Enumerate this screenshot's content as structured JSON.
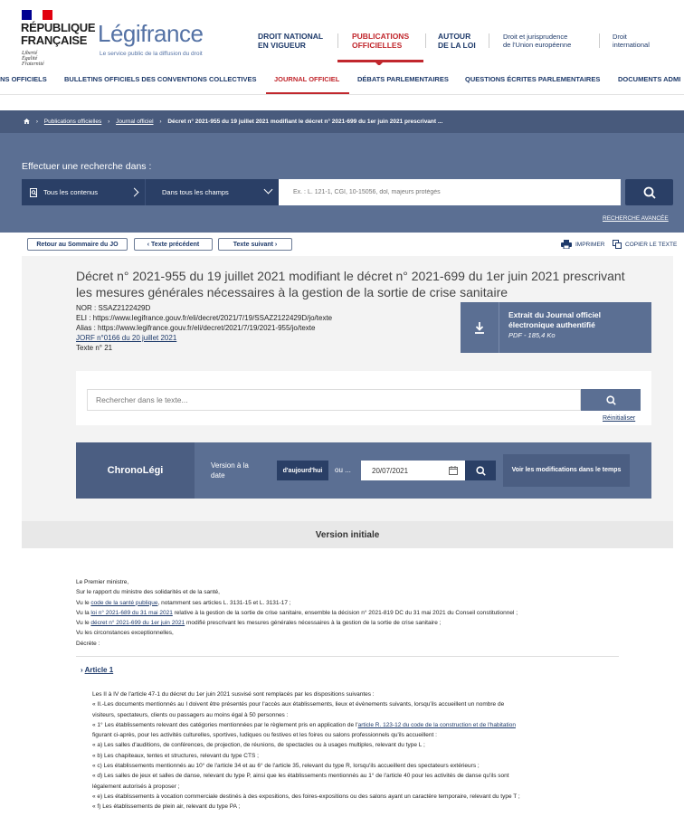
{
  "header": {
    "republic_line1": "RÉPUBLIQUE",
    "republic_line2": "FRANÇAISE",
    "motto1": "Liberté",
    "motto2": "Égalité",
    "motto3": "Fraternité",
    "logo": "Légifrance",
    "tagline": "Le service public de la diffusion du droit",
    "nav": [
      {
        "line1": "DROIT NATIONAL",
        "line2": "EN VIGUEUR"
      },
      {
        "line1": "PUBLICATIONS",
        "line2": "OFFICIELLES"
      },
      {
        "line1": "AUTOUR",
        "line2": "DE LA LOI"
      },
      {
        "line1": "Droit et jurisprudence",
        "line2": "de l'Union européenne"
      },
      {
        "line1": "Droit",
        "line2": "international"
      }
    ]
  },
  "subnav": [
    "INS OFFICIELS",
    "BULLETINS OFFICIELS DES CONVENTIONS COLLECTIVES",
    "JOURNAL OFFICIEL",
    "DÉBATS PARLEMENTAIRES",
    "QUESTIONS ÉCRITES PARLEMENTAIRES",
    "DOCUMENTS ADMI"
  ],
  "breadcrumb": {
    "item1": "Publications officielles",
    "item2": "Journal officiel",
    "current": "Décret n° 2021-955 du 19 juillet 2021 modifiant le décret n° 2021-699 du 1er juin 2021 prescrivant ..."
  },
  "search": {
    "label": "Effectuer une recherche dans :",
    "scope": "Tous les contenus",
    "fields": "Dans tous les champs",
    "placeholder": "Ex. : L. 121-1, CGI, 10-15056, dol, majeurs protégés",
    "advanced": "RECHERCHE AVANCÉE"
  },
  "toolbar": {
    "back": "Retour au Sommaire du JO",
    "prev": "‹ Texte précédent",
    "next": "Texte suivant ›",
    "print": "IMPRIMER",
    "copy": "COPIER LE TEXTE"
  },
  "document": {
    "title": "Décret n° 2021-955 du 19 juillet 2021 modifiant le décret n° 2021-699 du 1er juin 2021 prescrivant les mesures générales nécessaires à la gestion de la sortie de crise sanitaire",
    "nor": "NOR : SSAZ2122429D",
    "eli": "ELI : https://www.legifrance.gouv.fr/eli/decret/2021/7/19/SSAZ2122429D/jo/texte",
    "alias": "Alias : https://www.legifrance.gouv.fr/eli/decret/2021/7/19/2021-955/jo/texte",
    "jorf": "JORF n°0166 du 20 juillet 2021",
    "texte": "Texte n° 21",
    "extract_title1": "Extrait du Journal officiel",
    "extract_title2": "électronique authentifié",
    "extract_size": "PDF - 185,4 Ko"
  },
  "text_search": {
    "placeholder": "Rechercher dans le texte...",
    "reset": "Réinitialiser"
  },
  "chrono": {
    "title": "ChronoLégi",
    "label1": "Version à la",
    "label2": "date",
    "today": "d'aujourd'hui",
    "or": "ou ...",
    "date": "20/07/2021",
    "mods": "Voir les modifications dans le temps"
  },
  "version": "Version initiale",
  "body": {
    "p1": "Le Premier ministre,",
    "p2": "Sur le rapport du ministre des solidarités et de la santé,",
    "p3_a": "Vu le ",
    "p3_link": "code de la santé publique",
    "p3_b": ", notamment ses articles L. 3131-15 et L. 3131-17 ;",
    "p4_a": "Vu la ",
    "p4_link": "loi n° 2021-689 du 31 mai 2021",
    "p4_b": " relative à la gestion de la sortie de crise sanitaire, ensemble la décision n° 2021-819 DC du 31 mai 2021 du Conseil constitutionnel ;",
    "p5_a": "Vu le ",
    "p5_link": "décret n° 2021-699 du 1er juin 2021",
    "p5_b": " modifié prescrivant les mesures générales nécessaires à la gestion de la sortie de crise sanitaire ;",
    "p6": "Vu les circonstances exceptionnelles,",
    "p7": "Décrète :"
  },
  "article": {
    "arrow": "›",
    "title": "Article 1",
    "l1": "Les II à IV de l'article 47-1 du décret du 1er juin 2021 susvisé sont remplacés par les dispositions suivantes :",
    "l2": "« II.-Les documents mentionnés au I doivent être présentés pour l'accès aux établissements, lieux et évènements suivants, lorsqu'ils accueillent un nombre de",
    "l3": "visiteurs, spectateurs, clients ou passagers au moins égal à 50 personnes :",
    "l4_a": "« 1° Les établissements relevant des catégories mentionnées par le règlement pris en application de l'",
    "l4_link": "article R. 123-12 du code de la construction et de l'habitation",
    "l5": "figurant ci-après, pour les activités culturelles, sportives, ludiques ou festives et les foires ou salons professionnels qu'ils accueillent :",
    "l6": "« a) Les salles d'auditions, de conférences, de projection, de réunions, de spectacles ou à usages multiples, relevant du type L ;",
    "l7": "« b) Les chapiteaux, tentes et structures, relevant du type CTS ;",
    "l8": "« c) Les établissements mentionnés au 10° de l'article 34 et au 6° de l'article 35, relevant du type R, lorsqu'ils accueillent des spectateurs extérieurs ;",
    "l9": "« d) Les salles de jeux et salles de danse, relevant du type P, ainsi que les établissements mentionnés au 1° de l'article 40 pour les activités de danse qu'ils sont",
    "l10": "légalement autorisés à proposer ;",
    "l11": "« e) Les établissements à vocation commerciale destinés à des expositions, des foires-expositions ou des salons ayant un caractère temporaire, relevant du type T ;",
    "l12": "« f) Les établissements de plein air, relevant du type PA ;"
  }
}
